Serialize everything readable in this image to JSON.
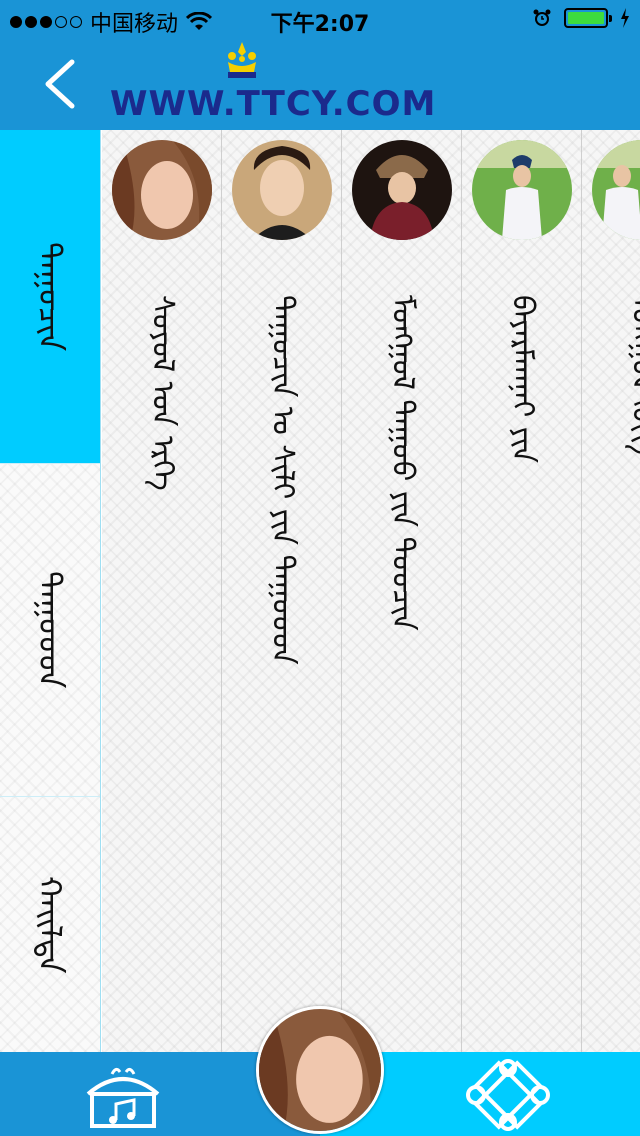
{
  "status_bar": {
    "carrier": "中国移动",
    "time": "下午2:07",
    "signal_dots_filled": 3,
    "signal_dots_total": 5,
    "battery_level": 1.0
  },
  "navbar": {
    "logo_text": "www.TTCY.com",
    "logo_display": "WWW.TTCY.COM"
  },
  "sidebar": {
    "tabs": [
      {
        "label": "ᠳᠠᠭᠤᠴᠢᠨ",
        "active": true
      },
      {
        "label": "ᠳᠠᠭᠤᠤᠳ",
        "active": false
      },
      {
        "label": "ᠬᠠᠢᠯᠲᠠ",
        "active": false
      }
    ]
  },
  "singers": [
    {
      "name": "ᠰᠣᠶᠤᠯ ᠤᠨ ᠡᠷᠬᠡ"
    },
    {
      "name": "ᠳᠠᠭᠤᠴᠢᠨ ᠤ ᠰᠢᠯᠢ ᠶᠢᠨ ᠳᠠᠭᠤᠤᠳ"
    },
    {
      "name": "ᠮᠣᠩᠭᠣᠯ ᠳᠠᠭᠤᠤ ᠶᠢᠨ ᠳᠣᠤᠴᠢᠨ"
    },
    {
      "name": "ᠪᠠᠶᠠᠷᠮᠠᠭᠨᠠᠢ ᠶᠢᠨ"
    },
    {
      "name": "ᠮᠣᠩᠭᠣᠯ ᠬᠥᠭ"
    }
  ],
  "colors": {
    "header_blue": "#1a94d6",
    "accent_cyan": "#00ccff",
    "logo_navy": "#1b2a8c",
    "logo_yellow": "#f5d000"
  },
  "icons": {
    "back": "chevron-left-icon",
    "home": "yurt-music-icon",
    "knot": "endless-knot-icon"
  }
}
